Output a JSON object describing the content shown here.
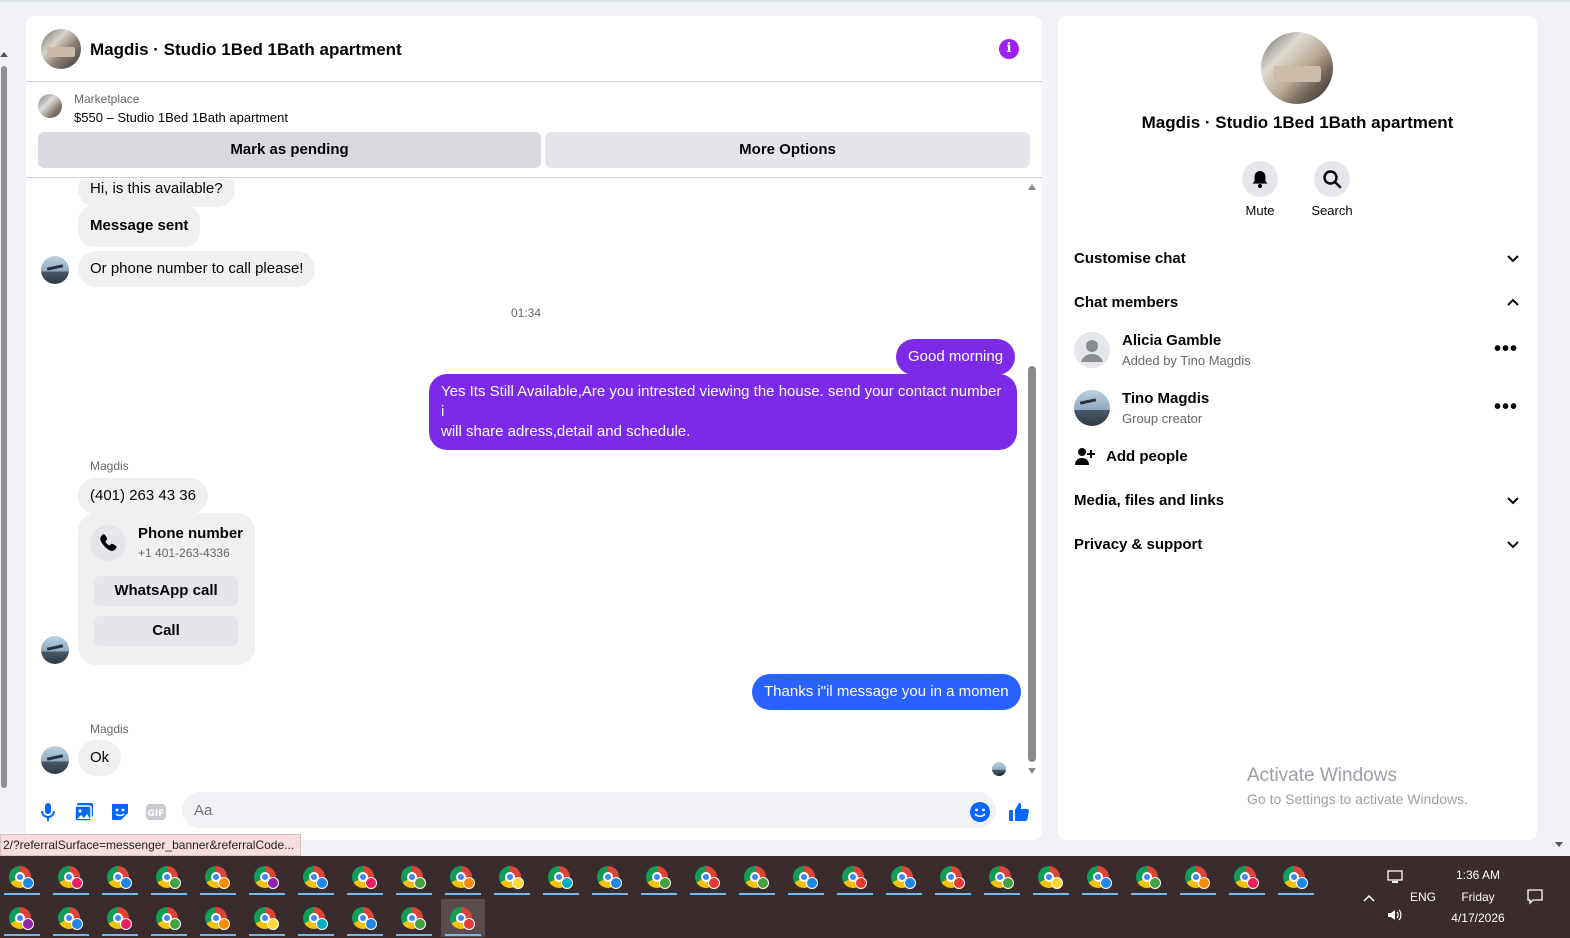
{
  "chat": {
    "title": "Magdis · Studio 1Bed 1Bath apartment",
    "listing": {
      "kind": "Marketplace",
      "price_title": "$550 – Studio 1Bed 1Bath apartment",
      "mark_pending": "Mark as pending",
      "more_options": "More Options"
    },
    "messages": {
      "m1": "Hi, is this available?",
      "m2": "Message sent",
      "m3": "Or phone number to call please!",
      "time": "01:34",
      "m4": "Good morning",
      "m5_line1": "Yes Its Still Available,Are you intrested viewing the house. send your contact number i",
      "m5_line2": "will share adress,detail and schedule.",
      "sender1": "Magdis",
      "m6": "(401) 263 43 36",
      "phone_card": {
        "title": "Phone number",
        "number": "+1 401-263-4336",
        "whatsapp": "WhatsApp call",
        "call": "Call"
      },
      "m7": "Thanks i\"il message you in a momen",
      "sender2": "Magdis",
      "m8": "Ok"
    },
    "composer": {
      "placeholder": "Aa"
    },
    "colors": {
      "accent": "#7d2ae8",
      "out_blue": "#2962ff",
      "icon_blue": "#0866ff"
    }
  },
  "status_url": "2/?referralSurface=messenger_banner&referralCode...",
  "info": {
    "title": "Magdis · Studio 1Bed 1Bath apartment",
    "mute": "Mute",
    "search": "Search",
    "customise": "Customise chat",
    "members_header": "Chat members",
    "members": [
      {
        "name": "Alicia Gamble",
        "role": "Added by Tino Magdis"
      },
      {
        "name": "Tino Magdis",
        "role": "Group creator"
      }
    ],
    "add_people": "Add people",
    "media": "Media, files and links",
    "privacy": "Privacy & support"
  },
  "watermark": {
    "line1": "Activate Windows",
    "line2": "Go to Settings to activate Windows."
  },
  "taskbar": {
    "time": "1:36 AM",
    "day": "Friday",
    "date": "4/17/2026",
    "lang": "ENG"
  }
}
